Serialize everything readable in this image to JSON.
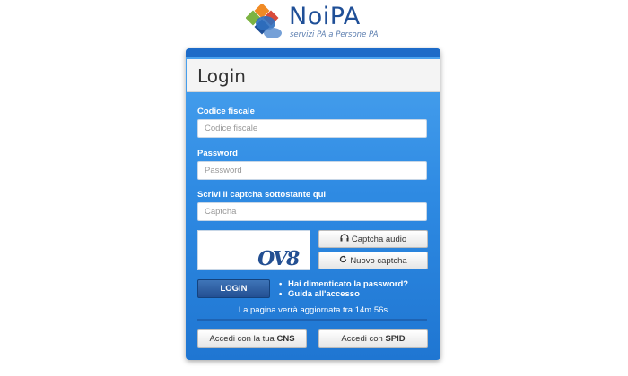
{
  "brand": {
    "name_prefix": "Noi",
    "name_suffix": "PA",
    "tagline": "servizi PA a Persone PA",
    "colors": {
      "blue": "#1f4f97",
      "green": "#7cb342",
      "orange": "#f08a24",
      "red": "#d84a3a"
    }
  },
  "login": {
    "title": "Login",
    "codice_fiscale": {
      "label": "Codice fiscale",
      "placeholder": "Codice fiscale",
      "value": ""
    },
    "password": {
      "label": "Password",
      "placeholder": "Password",
      "value": ""
    },
    "captcha": {
      "label": "Scrivi il captcha sottostante qui",
      "placeholder": "Captcha",
      "value": "",
      "image_text": "OV8"
    },
    "captcha_audio_label": "Captcha audio",
    "new_captcha_label": "Nuovo captcha",
    "login_button_label": "LOGIN",
    "help_links": [
      "Hai dimenticato la password?",
      "Guida all'accesso"
    ],
    "refresh_note": "La pagina verrà aggiornata tra 14m 56s",
    "cns_button": {
      "prefix": "Accedi con la tua ",
      "bold": "CNS"
    },
    "spid_button": {
      "prefix": "Accedi con ",
      "bold": "SPID"
    }
  },
  "icons": {
    "audio": "headphones-icon",
    "refresh": "refresh-icon"
  }
}
